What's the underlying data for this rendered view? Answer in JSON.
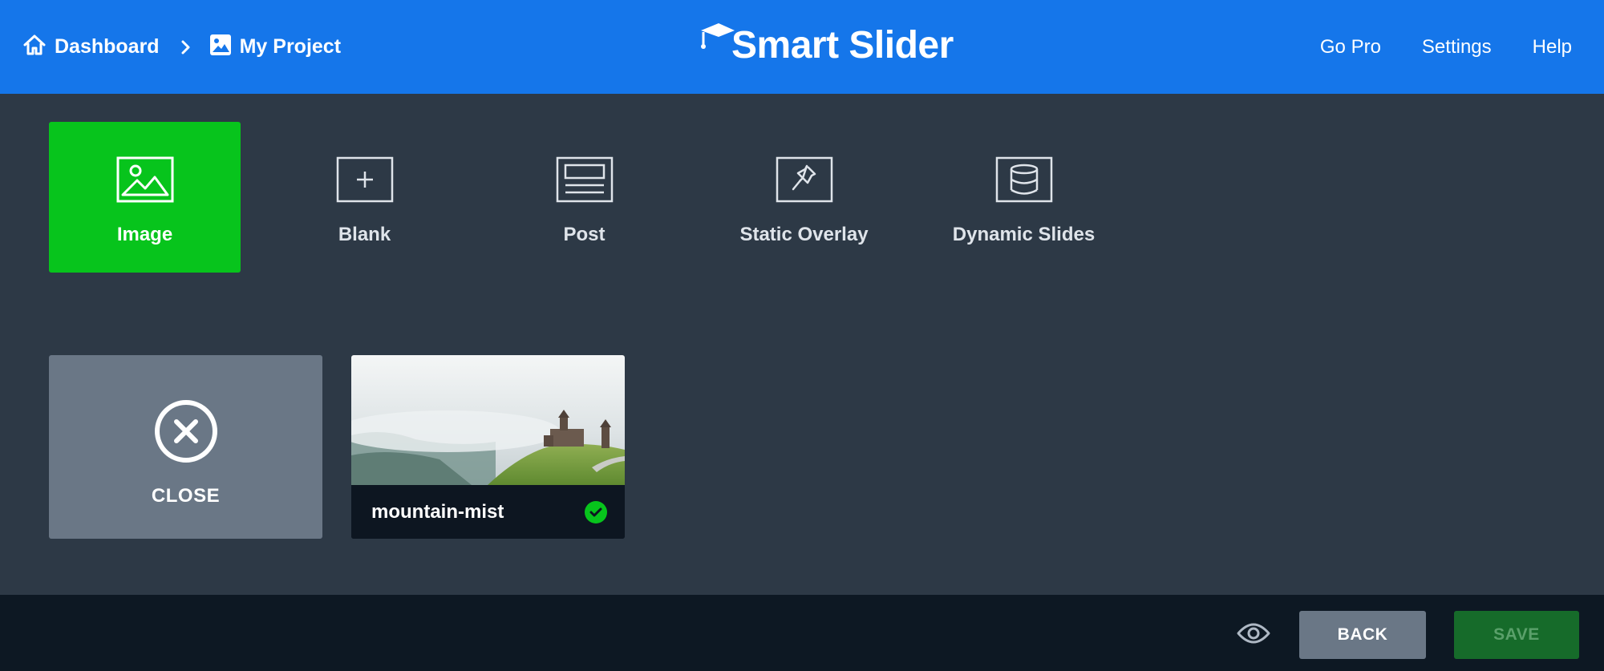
{
  "header": {
    "breadcrumb": [
      {
        "label": "Dashboard",
        "icon": "home-icon"
      },
      {
        "label": "My Project",
        "icon": "image-icon"
      }
    ],
    "logo_text": "Smart Slider",
    "nav": [
      "Go Pro",
      "Settings",
      "Help"
    ],
    "color": "#1576ea"
  },
  "slide_types": [
    {
      "label": "Image",
      "icon": "image-icon",
      "active": true
    },
    {
      "label": "Blank",
      "icon": "plus-square-icon",
      "active": false
    },
    {
      "label": "Post",
      "icon": "post-layout-icon",
      "active": false
    },
    {
      "label": "Static Overlay",
      "icon": "pin-icon",
      "active": false
    },
    {
      "label": "Dynamic Slides",
      "icon": "database-icon",
      "active": false
    }
  ],
  "cards": {
    "close_label": "CLOSE",
    "slides": [
      {
        "name": "mountain-mist",
        "selected": true
      }
    ]
  },
  "footer": {
    "back_label": "BACK",
    "save_label": "SAVE"
  },
  "colors": {
    "accent_green": "#07c41c",
    "background": "#2d3946",
    "footer_bg": "#0d1823"
  }
}
